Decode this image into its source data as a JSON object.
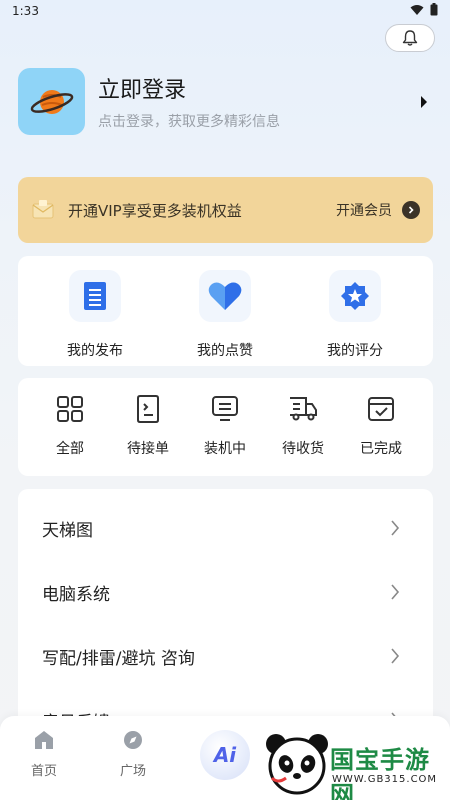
{
  "status_bar": {
    "time": "1:33"
  },
  "profile": {
    "title": "立即登录",
    "subtitle": "点击登录，获取更多精彩信息"
  },
  "vip": {
    "text": "开通VIP享受更多装机权益",
    "action": "开通会员"
  },
  "activity": [
    {
      "label": "我的发布",
      "icon": "document-icon"
    },
    {
      "label": "我的点赞",
      "icon": "heart-icon"
    },
    {
      "label": "我的评分",
      "icon": "star-badge-icon"
    }
  ],
  "orders": [
    {
      "label": "全部",
      "icon": "grid-icon"
    },
    {
      "label": "待接单",
      "icon": "order-doc-icon"
    },
    {
      "label": "装机中",
      "icon": "monitor-icon"
    },
    {
      "label": "待收货",
      "icon": "truck-icon"
    },
    {
      "label": "已完成",
      "icon": "check-box-icon"
    }
  ],
  "menu": [
    {
      "label": "天梯图"
    },
    {
      "label": "电脑系统"
    },
    {
      "label": "写配/排雷/避坑 咨询"
    },
    {
      "label": "意见反馈"
    }
  ],
  "tabbar": {
    "home": "首页",
    "plaza": "广场",
    "ai": "Ai"
  },
  "watermark": {
    "brand": "国宝手游网",
    "url": "WWW.GB315.COM"
  },
  "colors": {
    "accent_blue": "#2f6fe8",
    "vip_bg": "#f2d59a",
    "watermark_green": "#1e8a45"
  }
}
